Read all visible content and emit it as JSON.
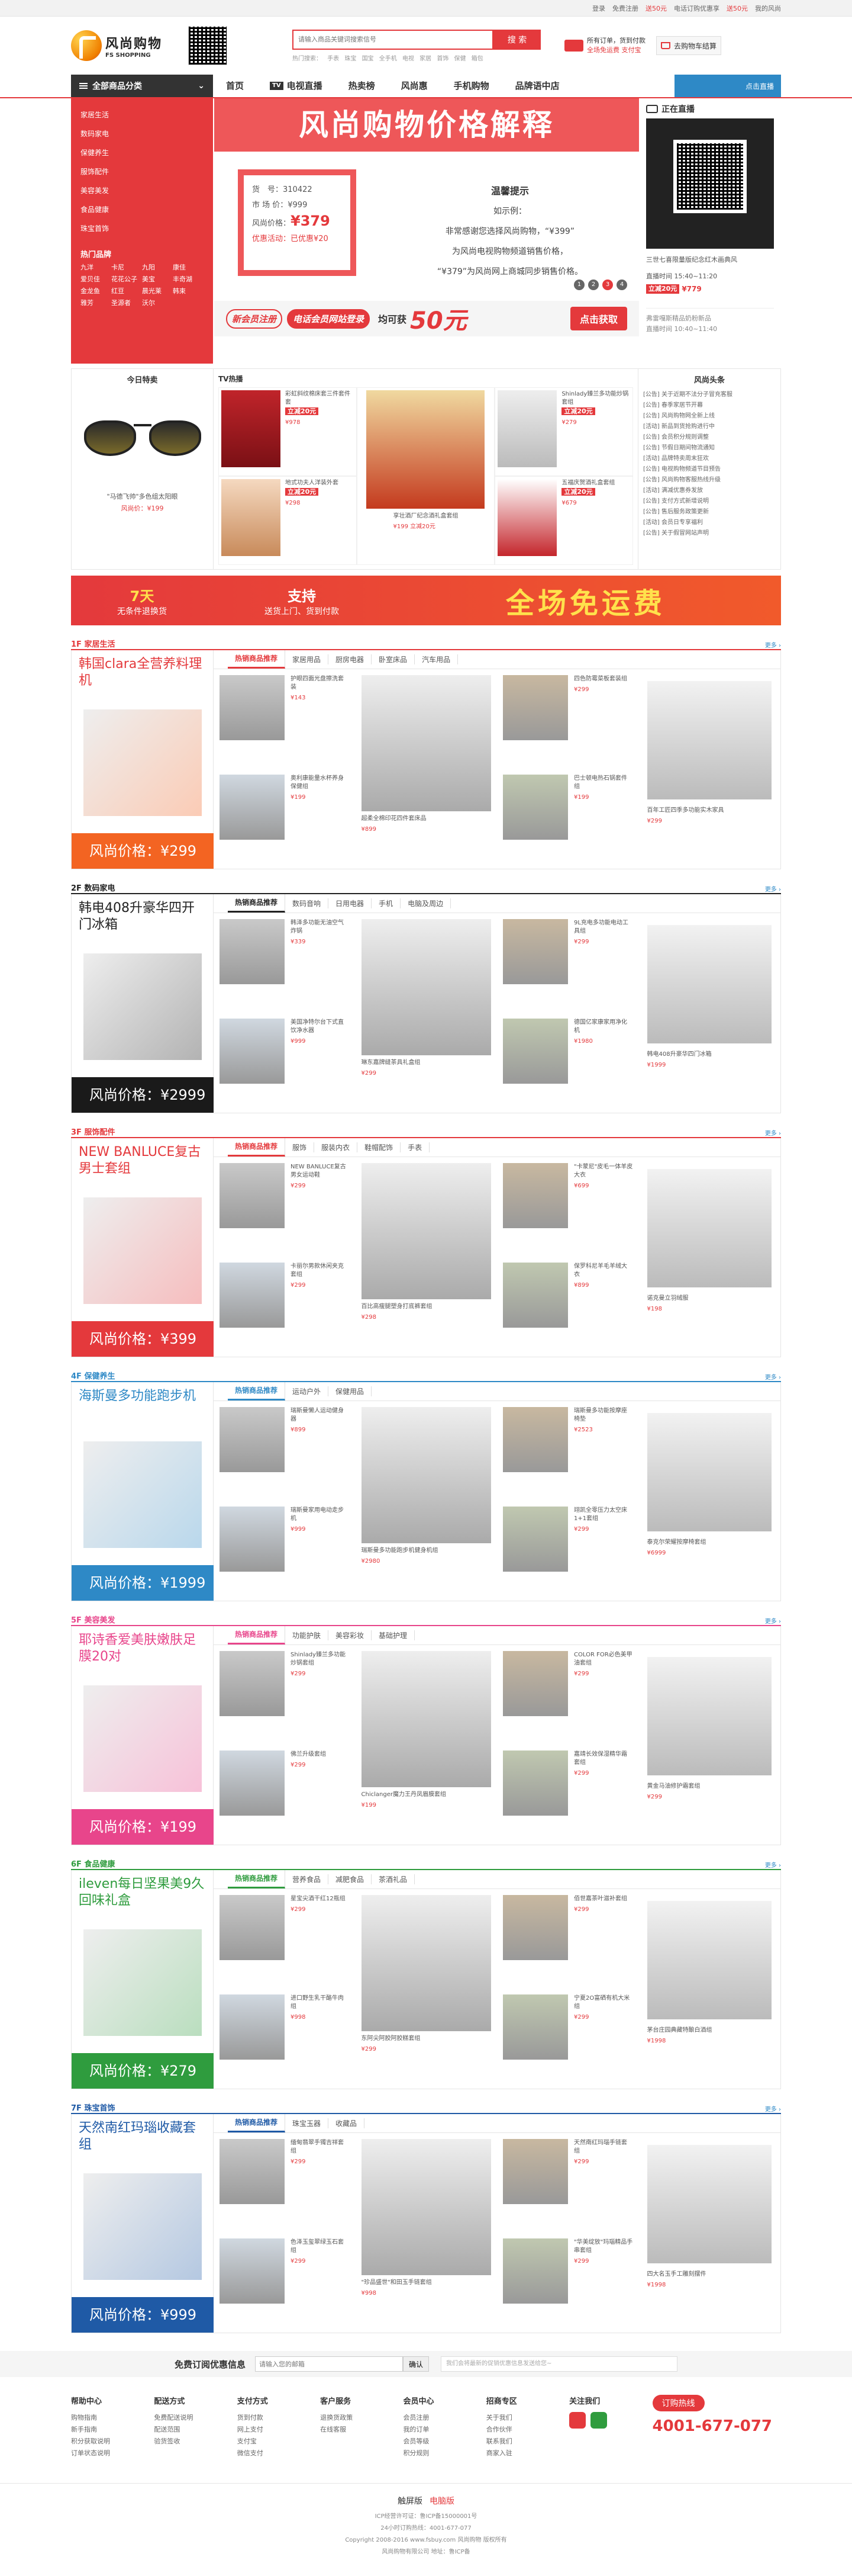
{
  "topbar": {
    "items": [
      "登录",
      "免费注册",
      "送50元",
      "电话订购优惠享",
      "送50元",
      "我的风尚"
    ]
  },
  "header": {
    "logo_cn": "风尚购物",
    "logo_en": "FS SHOPPING",
    "search_placeholder": "请输入商品关键词搜索信号",
    "search_btn": "搜 索",
    "hot_label": "热门搜索：",
    "hot_words": [
      "手表",
      "珠宝",
      "国宝",
      "全手机",
      "电视",
      "家居",
      "首饰",
      "保健",
      "箱包"
    ],
    "shipping_line1": "所有订单，货到付款",
    "shipping_line2": "全场免运费 支付宝",
    "cart": "去购物车结算"
  },
  "nav": {
    "cat_label": "全部商品分类",
    "items": [
      "首页",
      "电视直播",
      "热卖榜",
      "风尚惠",
      "手机购物",
      "品牌语中店"
    ],
    "tv_badge": "TV",
    "live_tab": "点击直播"
  },
  "sidecat": {
    "items": [
      "家居生活",
      "数码家电",
      "保健养生",
      "服饰配件",
      "美容美发",
      "食品健康",
      "珠宝首饰"
    ],
    "hot_title": "热门品牌",
    "brands": [
      "九洋",
      "卡尼",
      "九阳",
      "康佳",
      "爱贝佳",
      "花花公子",
      "美宝",
      "丰奇湖",
      "金龙鱼",
      "红豆",
      "晨光莱",
      "韩束",
      "雅芳",
      "圣源者",
      "沃尔",
      ""
    ]
  },
  "banner": {
    "title": "风尚购物价格解释",
    "card": {
      "r1": "货　号：310422",
      "r2": "市 场 价：¥999",
      "r3_label": "风尚价格：",
      "r3_value": "¥379",
      "r4": "优惠活动：已优惠¥20"
    },
    "tips_title": "温馨提示",
    "tips_sub": "如示例：",
    "tips_lines": [
      "非常感谢您选择风尚购物，“¥399”",
      "为风尚电视购物频道销售价格，",
      "“¥379”为风尚网上商城同步销售价格。"
    ],
    "dots": [
      "1",
      "2",
      "3",
      "4"
    ],
    "bottom": {
      "t1": "新会员注册",
      "t2": "电话会员网站登录",
      "t3": "均可获",
      "t4": "50元",
      "btn": "点击获取"
    }
  },
  "live": {
    "title": "正在直播",
    "time": "三世七喜限量版纪念红木画典风",
    "time2": "直播时间 15:40~11:20",
    "price_tag": "立减20元",
    "price": "¥779",
    "next": "弗雷嘎斯精品奶粉新品",
    "next_time": "直播时间 10:40~11:40"
  },
  "today": {
    "title": "今日特卖",
    "name": "\"马德飞帅\"多色组太阳眼",
    "price": "风尚价：¥199"
  },
  "tvhot": {
    "title": "TV热播",
    "items": [
      {
        "name": "彩虹斜纹棉床套三件套件套",
        "tag": "立减20元",
        "price": "¥978"
      },
      {
        "name": "",
        "tag": "",
        "price": ""
      },
      {
        "name": "Shinlady臻兰多功能炒锅套组",
        "tag": "立减20元",
        "price": "¥279"
      },
      {
        "name": "地式功夫人洋装外套",
        "tag": "立减20元",
        "price": "¥298"
      },
      {
        "name": "",
        "tag": "",
        "price": ""
      },
      {
        "name": "五福庆贺酒礼盒套组",
        "tag": "立减20元",
        "price": "¥679"
      }
    ],
    "big_items": [
      "享壮酒厂纪念酒礼盒套组",
      "¥199 立减20元"
    ]
  },
  "news": {
    "title": "风尚头条",
    "items": [
      "[公告] 关于近期不法分子冒充客服",
      "[公告] 春季家居节开幕",
      "[公告] 风尚购物网全新上线",
      "[活动] 新品到货抢购进行中",
      "[公告] 会员积分规则调整",
      "[公告] 节假日期间物流通知",
      "[活动] 品牌特卖周末狂欢",
      "[公告] 电视购物频道节目预告",
      "[公告] 风尚购物客服热线升级",
      "[活动] 满减优惠券发放",
      "[公告] 支付方式新增说明",
      "[公告] 售后服务政策更新",
      "[活动] 会员日专享福利",
      "[公告] 关于假冒网站声明"
    ]
  },
  "promo": {
    "b_big": "7天",
    "b_small": "无条件退换货",
    "c_big": "支持",
    "c_small": "送货上门、货到付款",
    "d": "全场免运费"
  },
  "floors": [
    {
      "name": "1F 家居生活",
      "color": "#e4393c",
      "feat_title": "韩国clara全营养料理机",
      "feat_price": "风尚价格：¥299",
      "feat_bg": "#f36422",
      "tabs": [
        "热销商品推荐",
        "家居用品",
        "厨房电器",
        "卧室床品",
        "汽车用品"
      ],
      "items": [
        {
          "name": "护眼四面光盘擦洗套装",
          "price": "¥143"
        },
        {
          "name": "超柔全棉印花四件套床品",
          "price": "¥899"
        },
        {
          "name": "四色防霉菜板套装组",
          "price": "¥299"
        },
        {
          "name": "百年工匠四季多功能实木家具",
          "price": "¥299"
        },
        {
          "name": "奥利康能量水杯养身保健组",
          "price": "¥199"
        },
        {
          "name": "",
          "price": ""
        },
        {
          "name": "巴士顿电热石锅套件组",
          "price": "¥199"
        },
        {
          "name": "",
          "price": ""
        }
      ]
    },
    {
      "name": "2F 数码家电",
      "color": "#222",
      "feat_title": "韩电408升豪华四开门冰箱",
      "feat_price": "风尚价格：¥2999",
      "feat_bg": "#1a1a1a",
      "tabs": [
        "热销商品推荐",
        "数码音响",
        "日用电器",
        "手机",
        "电脑及周边"
      ],
      "items": [
        {
          "name": "韩泽多功能无油空气炸锅",
          "price": "¥339"
        },
        {
          "name": "琳东嘉牌缝茶具礼盒组",
          "price": "¥299"
        },
        {
          "name": "9L充电多功能电动工具组",
          "price": "¥299"
        },
        {
          "name": "韩电408升豪华四门冰箱",
          "price": "¥1999"
        },
        {
          "name": "美国净特尔台下式直饮净水器",
          "price": "¥999"
        },
        {
          "name": "",
          "price": ""
        },
        {
          "name": "德国亿家康家用净化机",
          "price": "¥1980"
        },
        {
          "name": "",
          "price": ""
        }
      ]
    },
    {
      "name": "3F 服饰配件",
      "color": "#e4393c",
      "feat_title": "NEW BANLUCE复古男士套组",
      "feat_price": "风尚价格：¥399",
      "feat_bg": "#e4393c",
      "tabs": [
        "热销商品推荐",
        "服饰",
        "服装内衣",
        "鞋帽配饰",
        "手表"
      ],
      "items": [
        {
          "name": "NEW BANLUCE复古男女运动鞋",
          "price": "¥299"
        },
        {
          "name": "百比高瘦腿塑身打底裤套组",
          "price": "¥298"
        },
        {
          "name": "\"卡蒙尼\"皮毛一体羊皮大衣",
          "price": "¥699"
        },
        {
          "name": "诺克曼立羽绒服",
          "price": "¥198"
        },
        {
          "name": "卡丽尔男款休闲夹克套组",
          "price": "¥299"
        },
        {
          "name": "",
          "price": ""
        },
        {
          "name": "保罗科尼羊毛羊绒大衣",
          "price": "¥899"
        },
        {
          "name": "",
          "price": ""
        }
      ]
    },
    {
      "name": "4F 保健养生",
      "color": "#2e89c6",
      "feat_title": "海斯曼多功能跑步机",
      "feat_price": "风尚价格：¥1999",
      "feat_bg": "#2e89c6",
      "tabs": [
        "热销商品推荐",
        "运动户外",
        "保健用品"
      ],
      "items": [
        {
          "name": "瑞斯曼懒人运动健身器",
          "price": "¥899"
        },
        {
          "name": "瑞斯曼多功能跑步机健身机组",
          "price": "¥2980"
        },
        {
          "name": "瑞斯曼多功能按摩座椅垫",
          "price": "¥2523"
        },
        {
          "name": "泰克尔荣耀按摩椅套组",
          "price": "¥6999"
        },
        {
          "name": "瑞斯曼家用电动走步机",
          "price": "¥999"
        },
        {
          "name": "",
          "price": ""
        },
        {
          "name": "翊凯全零压力太空床1+1套组",
          "price": "¥299"
        },
        {
          "name": "",
          "price": ""
        }
      ]
    },
    {
      "name": "5F 美容美发",
      "color": "#e8458b",
      "feat_title": "耶诗香爱美肤嫩肤足膜20对",
      "feat_price": "风尚价格：¥199",
      "feat_bg": "#e8458b",
      "tabs": [
        "热销商品推荐",
        "功能护肤",
        "美容彩妆",
        "基础护理"
      ],
      "items": [
        {
          "name": "Shinlady臻兰多功能炒锅套组",
          "price": "¥299"
        },
        {
          "name": "Chiclanger魔力王丹凤眉膜套组",
          "price": "¥199"
        },
        {
          "name": "COLOR FOR必色美甲油套组",
          "price": "¥299"
        },
        {
          "name": "黄金马油修护霜套组",
          "price": "¥299"
        },
        {
          "name": "佛兰升级套组",
          "price": "¥299"
        },
        {
          "name": "",
          "price": ""
        },
        {
          "name": "嘉靖长效保湿精华霜套组",
          "price": "¥299"
        },
        {
          "name": "",
          "price": ""
        }
      ]
    },
    {
      "name": "6F 食品健康",
      "color": "#2f9c3e",
      "feat_title": "ileven每日坚果美9久回味礼盒",
      "feat_price": "风尚价格：¥279",
      "feat_bg": "#2f9c3e",
      "tabs": [
        "热销商品推荐",
        "营养食品",
        "减肥食品",
        "茶酒礼品"
      ],
      "items": [
        {
          "name": "星宝尖酒干红12瓶组",
          "price": "¥299"
        },
        {
          "name": "东阿尖阿胶阿胶糕套组",
          "price": "¥299"
        },
        {
          "name": "佰世嘉茶叶滋补套组",
          "price": "¥299"
        },
        {
          "name": "茅台庄园典藏特酿白酒组",
          "price": "¥1998"
        },
        {
          "name": "进口野生乳干酪牛肉组",
          "price": "¥998"
        },
        {
          "name": "",
          "price": ""
        },
        {
          "name": "宁夏2O富硒有机大米组",
          "price": "¥299"
        },
        {
          "name": "",
          "price": ""
        }
      ]
    },
    {
      "name": "7F 珠宝首饰",
      "color": "#1f5aa6",
      "feat_title": "天然南红玛瑙收藏套组",
      "feat_price": "风尚价格：¥999",
      "feat_bg": "#1f5aa6",
      "tabs": [
        "热销商品推荐",
        "珠宝玉器",
        "收藏品"
      ],
      "items": [
        {
          "name": "缅甸翡翠手镯吉祥套组",
          "price": "¥299"
        },
        {
          "name": "\"珍品盛世\"和田玉手链套组",
          "price": "¥998"
        },
        {
          "name": "天然南红玛瑙手链套组",
          "price": "¥299"
        },
        {
          "name": "四大名玉手工雕刻摆件",
          "price": "¥1998"
        },
        {
          "name": "色泽玉玺翠绿玉石套组",
          "price": "¥299"
        },
        {
          "name": "",
          "price": ""
        },
        {
          "name": "\"华美绽放\"玛瑙精品手串套组",
          "price": "¥299"
        },
        {
          "name": "",
          "price": ""
        }
      ]
    }
  ],
  "subscribe": {
    "title": "免费订阅优惠信息",
    "placeholder": "请输入您的邮箱",
    "btn": "确认",
    "note": "我们会将最新的促销优惠信息发送给您~"
  },
  "footer": {
    "cols": [
      {
        "title": "帮助中心",
        "items": [
          "购物指南",
          "新手指南",
          "积分获取说明",
          "订单状态说明"
        ]
      },
      {
        "title": "配送方式",
        "items": [
          "免费配送说明",
          "配送范围",
          "验货签收"
        ]
      },
      {
        "title": "支付方式",
        "items": [
          "货到付款",
          "网上支付",
          "支付宝",
          "微信支付"
        ]
      },
      {
        "title": "客户服务",
        "items": [
          "退换货政策",
          "在线客服"
        ]
      },
      {
        "title": "会员中心",
        "items": [
          "会员注册",
          "我的订单",
          "会员等级",
          "积分规则"
        ]
      },
      {
        "title": "招商专区",
        "items": [
          "关于我们",
          "合作伙伴",
          "联系我们",
          "商家入驻"
        ]
      },
      {
        "title": "关注我们",
        "items": []
      }
    ],
    "hotline_label": "订购热线",
    "hotline": "4001-677-077"
  },
  "copyright": {
    "ver1": "触屏版",
    "ver2": "电脑版",
    "lines": [
      "ICP经营许可证：鲁ICP备15000001号",
      "24小时订购热线：4001-677-077",
      "Copyright 2008-2016 www.fsbuy.com 风尚购物 版权所有",
      "风尚购物有限公司 地址：鲁ICP备"
    ]
  },
  "colors": {
    "accent": "#e4393c",
    "blue": "#2e89c6"
  }
}
